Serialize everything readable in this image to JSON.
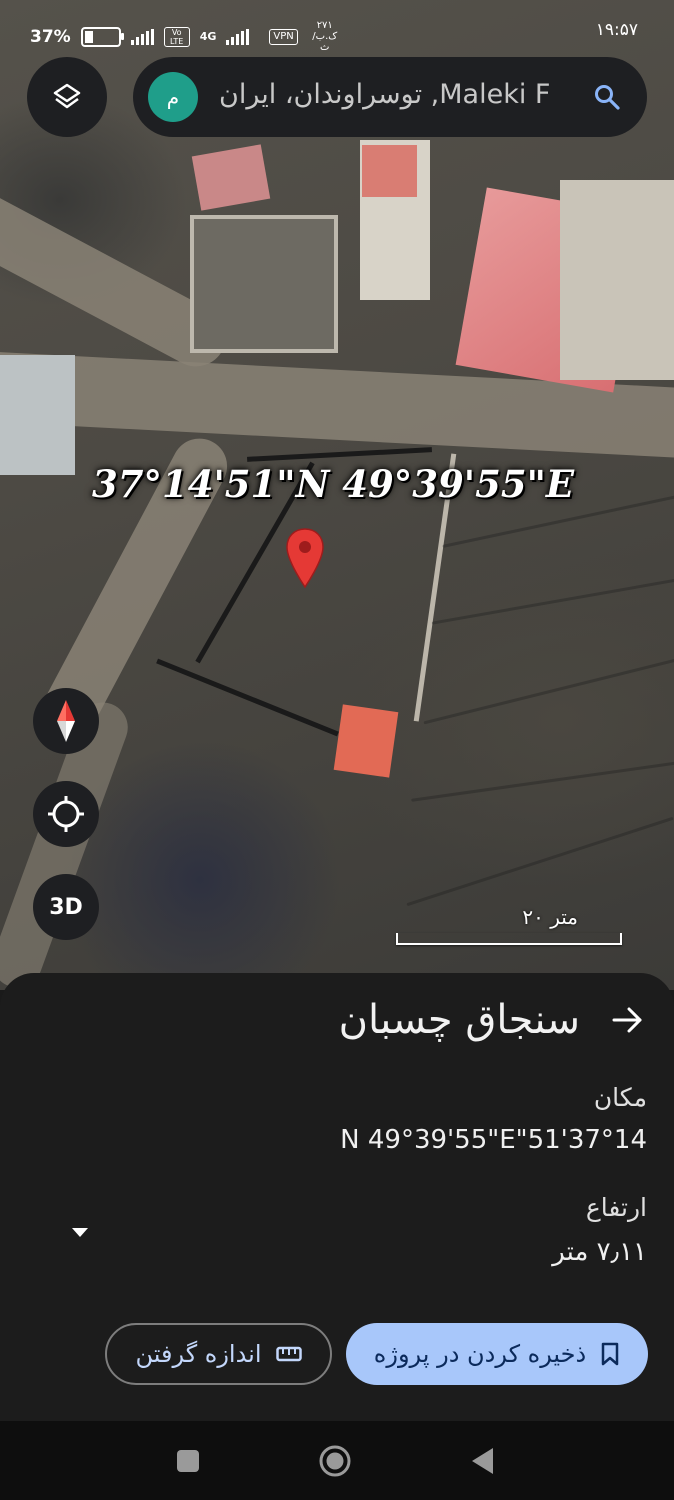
{
  "status_bar": {
    "battery": "37%",
    "network_4g": "4G",
    "volte": "Vo LTE",
    "vpn": "VPN",
    "data_speed": "۲۷۱ ک.ب/ث",
    "time": "۱۹:۵۷"
  },
  "search": {
    "avatar_letter": "م",
    "query": "Maleki F, توسراوندان، ایران",
    "icon": "search-icon"
  },
  "map": {
    "coordinates_overlay": "37°14'51\"N 49°39'55\"E",
    "compass_label": "",
    "three_d_label": "3D",
    "scale_label": "۲۰ متر",
    "pin_color": "#e53935"
  },
  "sheet": {
    "title": "سنجاق چسبان",
    "location_label": "مکان",
    "location_value": "N 49°39'55\"E\"51'37°14",
    "altitude_label": "ارتفاع",
    "altitude_value": "۷٫۱۱ متر",
    "save_label": "ذخیره کردن در پروژه",
    "measure_label": "اندازه گرفتن"
  },
  "colors": {
    "accent": "#a8c7fa",
    "sheet_bg": "#1c1c1c",
    "avatar": "#1f9e8a"
  }
}
